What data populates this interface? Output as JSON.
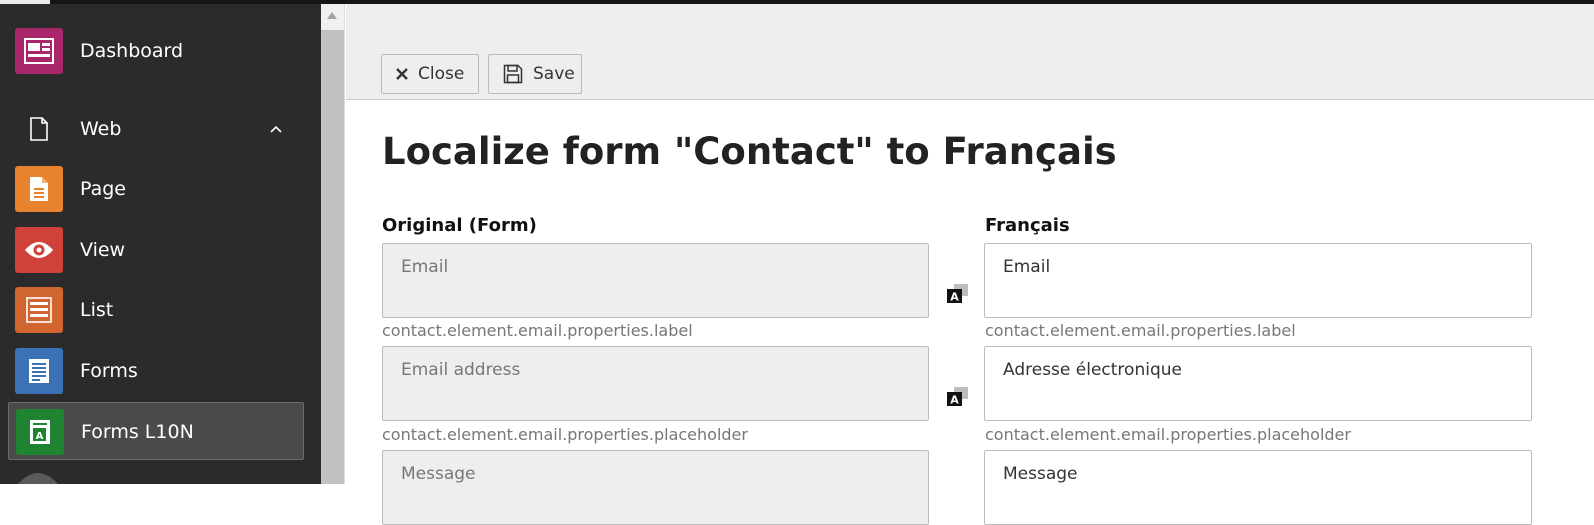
{
  "sidebar": {
    "items": [
      {
        "label": "Dashboard",
        "icon": "dashboard-icon",
        "color": "#a8266a"
      },
      {
        "label": "Web",
        "icon": "web-page-icon",
        "color": "#2b2b2b"
      },
      {
        "label": "Page",
        "icon": "page-icon",
        "color": "#e8822e"
      },
      {
        "label": "View",
        "icon": "view-icon",
        "color": "#d0413a"
      },
      {
        "label": "List",
        "icon": "list-icon",
        "color": "#d0652f"
      },
      {
        "label": "Forms",
        "icon": "forms-icon",
        "color": "#3a72b5"
      },
      {
        "label": "Forms L10N",
        "icon": "forms-l10n-icon",
        "color": "#1e8431"
      }
    ]
  },
  "toolbar": {
    "close_label": "Close",
    "save_label": "Save"
  },
  "main": {
    "title": "Localize form \"Contact\" to Français",
    "original_heading": "Original (Form)",
    "target_heading": "Français",
    "rows": [
      {
        "original": "Email",
        "translation": "Email",
        "key": "contact.element.email.properties.label"
      },
      {
        "original": "Email address",
        "translation": "Adresse électronique",
        "key": "contact.element.email.properties.placeholder"
      },
      {
        "original": "Message",
        "translation": "Message",
        "key": ""
      }
    ]
  }
}
